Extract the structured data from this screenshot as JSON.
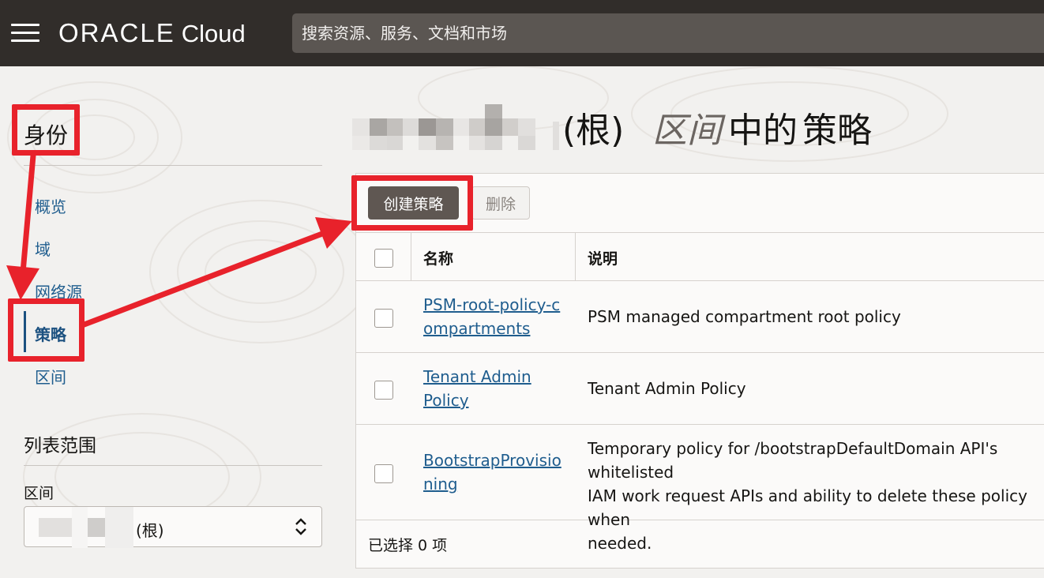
{
  "header": {
    "logo_oracle": "ORACLE",
    "logo_cloud": "Cloud",
    "search_placeholder": "搜索资源、服务、文档和市场"
  },
  "sidebar": {
    "title": "身份",
    "items": [
      {
        "label": "概览",
        "active": false
      },
      {
        "label": "域",
        "active": false
      },
      {
        "label": "网络源",
        "active": false
      },
      {
        "label": "策略",
        "active": true
      },
      {
        "label": "区间",
        "active": false
      }
    ],
    "scope": {
      "title": "列表范围",
      "compartment_label": "区间",
      "compartment_value": "(根)"
    }
  },
  "main": {
    "heading": {
      "root_suffix": "(根)",
      "compartment_word": "区间",
      "middle": "中的",
      "policies_word": "策略"
    },
    "toolbar": {
      "create_label": "创建策略",
      "delete_label": "删除"
    },
    "table": {
      "columns": [
        "名称",
        "说明"
      ],
      "rows": [
        {
          "name": "PSM-root-policy-compartments",
          "description": "PSM managed compartment root policy"
        },
        {
          "name": "Tenant Admin Policy",
          "description": "Tenant Admin Policy"
        },
        {
          "name": "BootstrapProvisioning",
          "description": "Temporary policy for /bootstrapDefaultDomain API's whitelisted\nIAM work request APIs and ability to delete these policy when\nneeded."
        }
      ],
      "footer": "已选择 0 项"
    }
  },
  "colors": {
    "header_bg": "#312d2a",
    "link": "#1f5d8e",
    "primary_button": "#5f5752",
    "annotation_red": "#e8222b"
  }
}
